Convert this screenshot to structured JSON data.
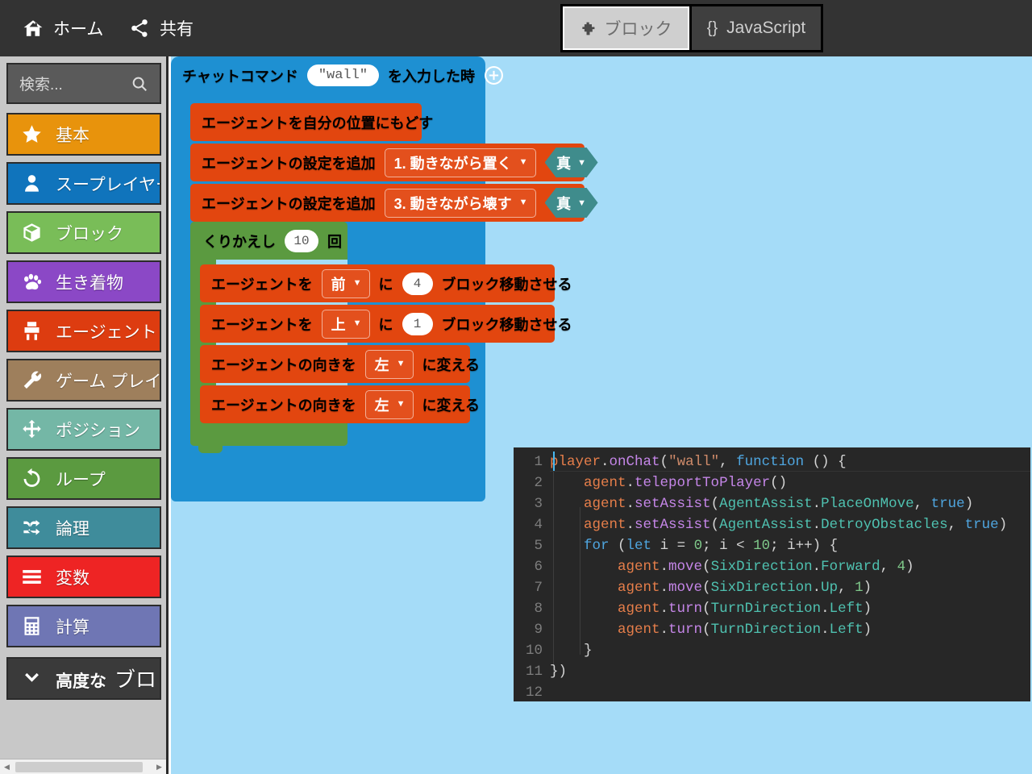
{
  "topbar": {
    "menu": [
      {
        "id": "home",
        "label": "ホーム",
        "icon": "home-icon"
      },
      {
        "id": "share",
        "label": "共有",
        "icon": "share-icon"
      }
    ],
    "tabs": [
      {
        "id": "blocks",
        "label": "ブロック",
        "icon": "puzzle-icon",
        "active": true
      },
      {
        "id": "javascript",
        "label": "JavaScript",
        "icon": "braces-icon",
        "active": false
      }
    ],
    "braces_glyph": "{}"
  },
  "sidebar": {
    "search": {
      "placeholder": "検索...",
      "value": "",
      "icon": "search-icon"
    },
    "categories": [
      {
        "label": "基本",
        "color": "#e8930c",
        "icon": "star-icon"
      },
      {
        "label": "スープレイヤー",
        "color": "#1074bc",
        "icon": "person-icon"
      },
      {
        "label": "ブロック",
        "color": "#79bd58",
        "icon": "cube-icon"
      },
      {
        "label": "生き着物",
        "color": "#8b48c6",
        "icon": "paw-icon"
      },
      {
        "label": "エージェント",
        "color": "#dd3c10",
        "icon": "agent-icon"
      },
      {
        "label": "ゲーム プレイ",
        "color": "#9e7f5c",
        "icon": "wrench-icon"
      },
      {
        "label": "ポジション",
        "color": "#74b7a6",
        "icon": "move-icon"
      },
      {
        "label": "ループ",
        "color": "#5b9a40",
        "icon": "loop-icon"
      },
      {
        "label": "論理",
        "color": "#3f8c9b",
        "icon": "shuffle-icon"
      },
      {
        "label": "変数",
        "color": "#ee2424",
        "icon": "lines-icon"
      },
      {
        "label": "計算",
        "color": "#6f76b4",
        "icon": "calculator-icon"
      }
    ],
    "advanced": {
      "label_bold": "高度な",
      "label_rest": "ブロック",
      "icon": "chevron-down-icon",
      "color": "#3a3a3a"
    }
  },
  "workspace": {
    "background": "#a5dcf8",
    "event_block": {
      "color": "#1e90d2",
      "prefix": "チャットコマンド",
      "command_value": "\"wall\"",
      "suffix": "を入力した時",
      "add_icon": "plus-circle-icon"
    },
    "statements": [
      {
        "id": "teleport",
        "color": "#e2460f",
        "text": "エージェントを自分の位置にもどす"
      },
      {
        "id": "assist-1",
        "color": "#e2460f",
        "text": "エージェントの設定を追加",
        "dropdown": "1. 動きながら置く",
        "bool": "真",
        "bool_color": "#3f8c8c"
      },
      {
        "id": "assist-3",
        "color": "#e2460f",
        "text": "エージェントの設定を追加",
        "dropdown": "3. 動きながら壊す",
        "bool": "真",
        "bool_color": "#3f8c8c"
      }
    ],
    "loop": {
      "color": "#5b9a40",
      "label": "くりかえし",
      "count": "10",
      "unit": "回",
      "unit_icon": "square-icon",
      "body": [
        {
          "id": "move-fwd",
          "color": "#e2460f",
          "pre": "エージェントを",
          "dropdown": "前",
          "mid": "に",
          "num": "4",
          "post": "ブロック移動させる"
        },
        {
          "id": "move-up",
          "color": "#e2460f",
          "pre": "エージェントを",
          "dropdown": "上",
          "mid": "に",
          "num": "1",
          "post": "ブロック移動させる"
        },
        {
          "id": "turn-left-1",
          "color": "#e2460f",
          "pre": "エージェントの向きを",
          "dropdown": "左",
          "post": "に変える"
        },
        {
          "id": "turn-left-2",
          "color": "#e2460f",
          "pre": "エージェントの向きを",
          "dropdown": "左",
          "post": "に変える"
        }
      ]
    }
  },
  "editor": {
    "background": "#272727",
    "line_numbers": [
      "1",
      "2",
      "3",
      "4",
      "5",
      "6",
      "7",
      "8",
      "9",
      "10",
      "11",
      "12"
    ],
    "lines": [
      [
        {
          "t": "player",
          "c": "t-ident"
        },
        {
          "t": ".",
          "c": "t-punc"
        },
        {
          "t": "onChat",
          "c": "t-fn"
        },
        {
          "t": "(",
          "c": "t-punc"
        },
        {
          "t": "\"wall\"",
          "c": "t-str"
        },
        {
          "t": ", ",
          "c": "t-punc"
        },
        {
          "t": "function",
          "c": "t-kw"
        },
        {
          "t": " () {",
          "c": "t-punc"
        }
      ],
      [
        {
          "t": "    ",
          "c": "t-plain"
        },
        {
          "t": "agent",
          "c": "t-ident"
        },
        {
          "t": ".",
          "c": "t-punc"
        },
        {
          "t": "teleportToPlayer",
          "c": "t-fn"
        },
        {
          "t": "()",
          "c": "t-punc"
        }
      ],
      [
        {
          "t": "    ",
          "c": "t-plain"
        },
        {
          "t": "agent",
          "c": "t-ident"
        },
        {
          "t": ".",
          "c": "t-punc"
        },
        {
          "t": "setAssist",
          "c": "t-fn"
        },
        {
          "t": "(",
          "c": "t-punc"
        },
        {
          "t": "AgentAssist",
          "c": "t-type"
        },
        {
          "t": ".",
          "c": "t-punc"
        },
        {
          "t": "PlaceOnMove",
          "c": "t-type"
        },
        {
          "t": ", ",
          "c": "t-punc"
        },
        {
          "t": "true",
          "c": "t-const"
        },
        {
          "t": ")",
          "c": "t-punc"
        }
      ],
      [
        {
          "t": "    ",
          "c": "t-plain"
        },
        {
          "t": "agent",
          "c": "t-ident"
        },
        {
          "t": ".",
          "c": "t-punc"
        },
        {
          "t": "setAssist",
          "c": "t-fn"
        },
        {
          "t": "(",
          "c": "t-punc"
        },
        {
          "t": "AgentAssist",
          "c": "t-type"
        },
        {
          "t": ".",
          "c": "t-punc"
        },
        {
          "t": "DetroyObstacles",
          "c": "t-type"
        },
        {
          "t": ", ",
          "c": "t-punc"
        },
        {
          "t": "true",
          "c": "t-const"
        },
        {
          "t": ")",
          "c": "t-punc"
        }
      ],
      [
        {
          "t": "    ",
          "c": "t-plain"
        },
        {
          "t": "for",
          "c": "t-kw"
        },
        {
          "t": " (",
          "c": "t-punc"
        },
        {
          "t": "let",
          "c": "t-kw"
        },
        {
          "t": " i = ",
          "c": "t-punc"
        },
        {
          "t": "0",
          "c": "t-num"
        },
        {
          "t": "; i < ",
          "c": "t-punc"
        },
        {
          "t": "10",
          "c": "t-num"
        },
        {
          "t": "; i++) {",
          "c": "t-punc"
        }
      ],
      [
        {
          "t": "        ",
          "c": "t-plain"
        },
        {
          "t": "agent",
          "c": "t-ident"
        },
        {
          "t": ".",
          "c": "t-punc"
        },
        {
          "t": "move",
          "c": "t-fn"
        },
        {
          "t": "(",
          "c": "t-punc"
        },
        {
          "t": "SixDirection",
          "c": "t-type"
        },
        {
          "t": ".",
          "c": "t-punc"
        },
        {
          "t": "Forward",
          "c": "t-type"
        },
        {
          "t": ", ",
          "c": "t-punc"
        },
        {
          "t": "4",
          "c": "t-num"
        },
        {
          "t": ")",
          "c": "t-punc"
        }
      ],
      [
        {
          "t": "        ",
          "c": "t-plain"
        },
        {
          "t": "agent",
          "c": "t-ident"
        },
        {
          "t": ".",
          "c": "t-punc"
        },
        {
          "t": "move",
          "c": "t-fn"
        },
        {
          "t": "(",
          "c": "t-punc"
        },
        {
          "t": "SixDirection",
          "c": "t-type"
        },
        {
          "t": ".",
          "c": "t-punc"
        },
        {
          "t": "Up",
          "c": "t-type"
        },
        {
          "t": ", ",
          "c": "t-punc"
        },
        {
          "t": "1",
          "c": "t-num"
        },
        {
          "t": ")",
          "c": "t-punc"
        }
      ],
      [
        {
          "t": "        ",
          "c": "t-plain"
        },
        {
          "t": "agent",
          "c": "t-ident"
        },
        {
          "t": ".",
          "c": "t-punc"
        },
        {
          "t": "turn",
          "c": "t-fn"
        },
        {
          "t": "(",
          "c": "t-punc"
        },
        {
          "t": "TurnDirection",
          "c": "t-type"
        },
        {
          "t": ".",
          "c": "t-punc"
        },
        {
          "t": "Left",
          "c": "t-type"
        },
        {
          "t": ")",
          "c": "t-punc"
        }
      ],
      [
        {
          "t": "        ",
          "c": "t-plain"
        },
        {
          "t": "agent",
          "c": "t-ident"
        },
        {
          "t": ".",
          "c": "t-punc"
        },
        {
          "t": "turn",
          "c": "t-fn"
        },
        {
          "t": "(",
          "c": "t-punc"
        },
        {
          "t": "TurnDirection",
          "c": "t-type"
        },
        {
          "t": ".",
          "c": "t-punc"
        },
        {
          "t": "Left",
          "c": "t-type"
        },
        {
          "t": ")",
          "c": "t-punc"
        }
      ],
      [
        {
          "t": "    }",
          "c": "t-punc"
        }
      ],
      [
        {
          "t": "})",
          "c": "t-punc"
        }
      ],
      [
        {
          "t": "",
          "c": "t-plain"
        }
      ]
    ]
  }
}
